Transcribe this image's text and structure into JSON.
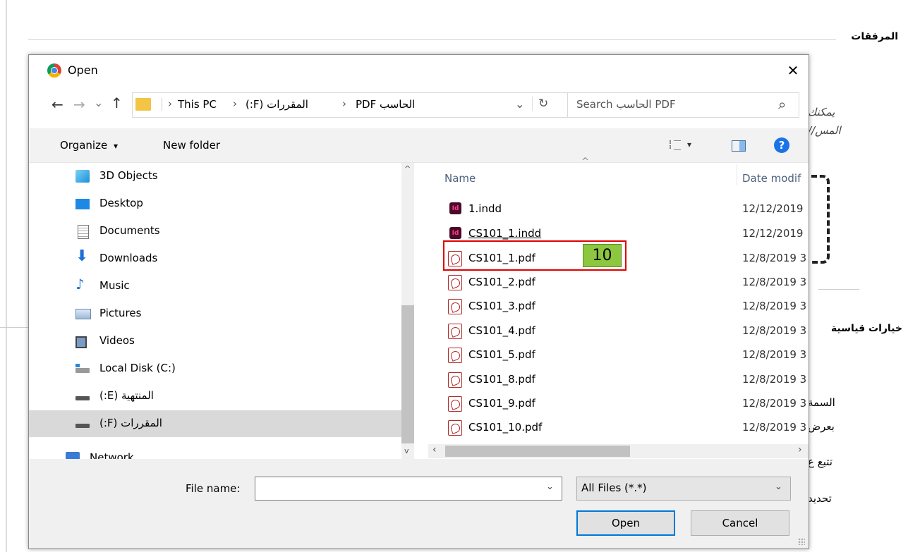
{
  "background": {
    "attachments_label": "المرفقات",
    "side_text_1": "يمكنك",
    "side_text_2": "المس//",
    "standard_options_label": "خيارات قياسية",
    "side_text_3": "السمة",
    "side_text_4": "بعرض",
    "side_text_5": "تتبع ع",
    "side_text_6": "تحديد"
  },
  "dialog": {
    "title": "Open",
    "close_glyph": "✕",
    "nav": {
      "back": "←",
      "forward": "→",
      "recent": "⌄",
      "up": "↑"
    },
    "address": {
      "sep": "›",
      "crumbs": [
        "This PC",
        "المقررات (F:)",
        "الحاسب PDF"
      ],
      "dropdown": "⌄",
      "refresh": "↻"
    },
    "search": {
      "placeholder": "Search الحاسب PDF",
      "icon": "⌕"
    },
    "toolbar": {
      "organize": "Organize",
      "organize_caret": "▾",
      "new_folder": "New folder",
      "view_caret": "▾",
      "help": "?"
    },
    "sidebar": {
      "items": [
        {
          "label": "3D Objects",
          "icon": "cube-icon"
        },
        {
          "label": "Desktop",
          "icon": "desktop-icon"
        },
        {
          "label": "Documents",
          "icon": "documents-icon"
        },
        {
          "label": "Downloads",
          "icon": "downloads-icon"
        },
        {
          "label": "Music",
          "icon": "music-icon"
        },
        {
          "label": "Pictures",
          "icon": "pictures-icon"
        },
        {
          "label": "Videos",
          "icon": "videos-icon"
        },
        {
          "label": "Local Disk (C:)",
          "icon": "local-disk-icon"
        },
        {
          "label": "المنتهية (E:)",
          "icon": "drive-icon"
        },
        {
          "label": "المقررات (F:)",
          "icon": "drive-icon",
          "selected": true
        },
        {
          "label": "Network",
          "icon": "network-icon"
        }
      ]
    },
    "columns": {
      "name": "Name",
      "date": "Date modif",
      "sort_glyph": "^"
    },
    "files": [
      {
        "name": "1.indd",
        "date": "12/12/2019",
        "type": "indd"
      },
      {
        "name": "CS101_1.indd",
        "date": "12/12/2019",
        "type": "indd"
      },
      {
        "name": "CS101_1.pdf",
        "date": "12/8/2019 3",
        "type": "pdf"
      },
      {
        "name": "CS101_2.pdf",
        "date": "12/8/2019 3",
        "type": "pdf"
      },
      {
        "name": "CS101_3.pdf",
        "date": "12/8/2019 3",
        "type": "pdf"
      },
      {
        "name": "CS101_4.pdf",
        "date": "12/8/2019 3",
        "type": "pdf"
      },
      {
        "name": "CS101_5.pdf",
        "date": "12/8/2019 3",
        "type": "pdf"
      },
      {
        "name": "CS101_8.pdf",
        "date": "12/8/2019 3",
        "type": "pdf"
      },
      {
        "name": "CS101_9.pdf",
        "date": "12/8/2019 3",
        "type": "pdf"
      },
      {
        "name": "CS101_10.pdf",
        "date": "12/8/2019 3",
        "type": "pdf"
      }
    ],
    "annotation_number": "10",
    "filename": {
      "label": "File name:",
      "value": ""
    },
    "filetype": {
      "value": "All Files (*.*)"
    },
    "open_button": "Open",
    "cancel_button": "Cancel"
  },
  "colors": {
    "accent": "#0078d7",
    "selected_bg": "#cce8ff",
    "highlight": "#e10000",
    "badge": "#8dc63f"
  }
}
